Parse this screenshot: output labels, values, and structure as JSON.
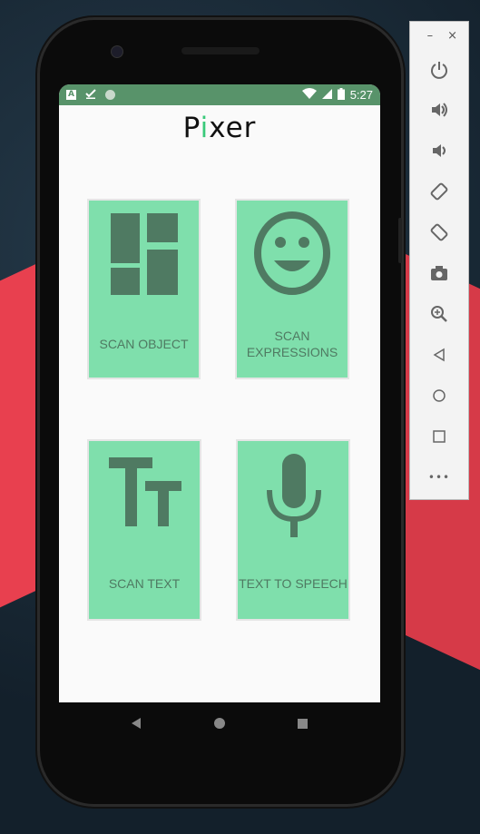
{
  "status_bar": {
    "left_icons": [
      "a-notification-icon",
      "check-download-icon",
      "circle-sync-icon"
    ],
    "right_icons": [
      "wifi-icon",
      "signal-icon",
      "battery-icon"
    ],
    "time": "5:27"
  },
  "app": {
    "title_p": "P",
    "title_i": "i",
    "title_rest": "xer",
    "accent_color": "#39c97a",
    "card_color": "#7fdfac",
    "icon_color": "#4f7a62"
  },
  "cards": [
    {
      "label": "SCAN OBJECT",
      "icon": "dashboard-grid-icon"
    },
    {
      "label_line1": "SCAN",
      "label_line2": "EXPRESSIONS",
      "icon": "smiley-face-icon"
    },
    {
      "label": "SCAN TEXT",
      "icon": "text-size-icon"
    },
    {
      "label": "TEXT TO SPEECH",
      "icon": "microphone-icon"
    }
  ],
  "navbar": {
    "buttons": [
      "back-button",
      "home-button",
      "recents-button"
    ]
  },
  "toolbar": {
    "minimize": "–",
    "close": "×",
    "items": [
      "power-icon",
      "volume-up-icon",
      "volume-down-icon",
      "rotate-left-icon",
      "rotate-right-icon",
      "camera-icon",
      "zoom-icon",
      "back-icon",
      "home-icon",
      "overview-icon",
      "more-icon"
    ],
    "more_label": "•••"
  }
}
